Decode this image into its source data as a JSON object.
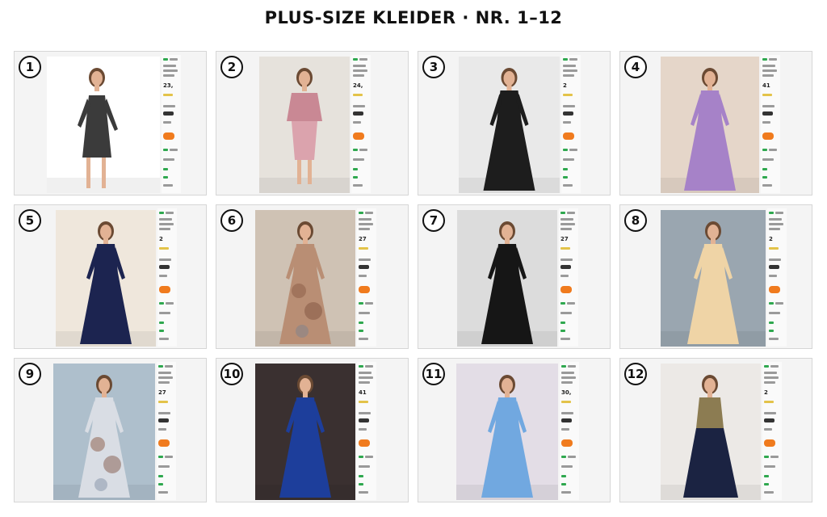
{
  "title": "PLUS-SIZE KLEIDER · NR. 1–12",
  "cards": [
    {
      "number": "1",
      "price": "23,",
      "dress_color": "#3b3b3b",
      "dress_style": "lace-short",
      "bg": "#ffffff"
    },
    {
      "number": "2",
      "price": "24,",
      "dress_color": "#dba3ad",
      "dress_style": "two-tone",
      "bg": "#e6e2dc"
    },
    {
      "number": "3",
      "price": "2",
      "dress_color": "#1d1d1d",
      "dress_style": "long",
      "bg": "#e9e9e9"
    },
    {
      "number": "4",
      "price": "41",
      "dress_color": "#a682c8",
      "dress_style": "long",
      "bg": "#e5d6c9"
    },
    {
      "number": "5",
      "price": "2",
      "dress_color": "#1c2450",
      "dress_style": "long",
      "bg": "#efe7dc"
    },
    {
      "number": "6",
      "price": "27",
      "dress_color": "#b98e74",
      "dress_style": "floral",
      "bg": "#cfc2b4"
    },
    {
      "number": "7",
      "price": "27",
      "dress_color": "#161616",
      "dress_style": "long",
      "bg": "#dcdcdc"
    },
    {
      "number": "8",
      "price": "2",
      "dress_color": "#efd4a6",
      "dress_style": "long",
      "bg": "#9aa6b0"
    },
    {
      "number": "9",
      "price": "27",
      "dress_color": "#d9dde4",
      "dress_style": "floral-long",
      "bg": "#aebfcc"
    },
    {
      "number": "10",
      "price": "41",
      "dress_color": "#1d3e9b",
      "dress_style": "long",
      "bg": "#3a3030"
    },
    {
      "number": "11",
      "price": "30,",
      "dress_color": "#71a8e0",
      "dress_style": "long",
      "bg": "#e3dde6"
    },
    {
      "number": "12",
      "price": "2",
      "dress_color": "#1b2342",
      "dress_style": "two-tone-long",
      "bg": "#ece9e6"
    }
  ]
}
